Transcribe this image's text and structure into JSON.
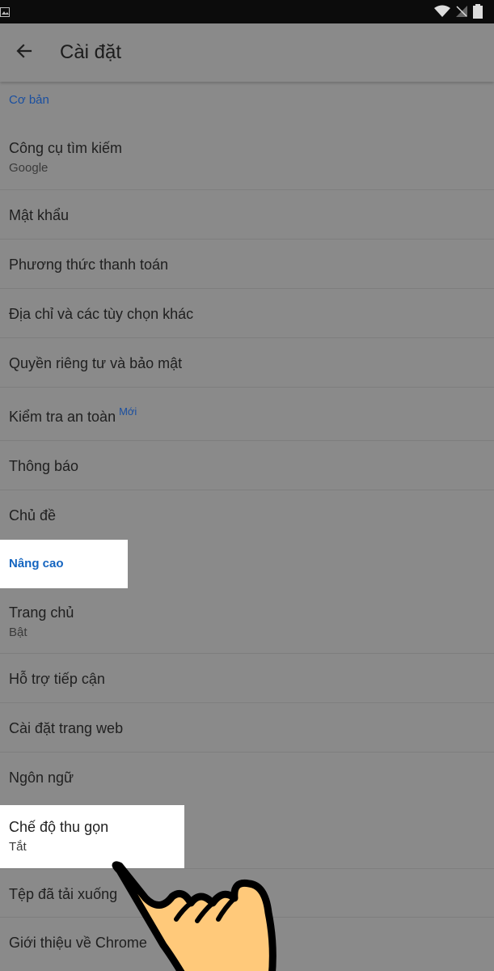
{
  "title": "Cài đặt",
  "sections": [
    {
      "header": "Cơ bản",
      "items": [
        {
          "label": "Công cụ tìm kiếm",
          "sub": "Google"
        },
        {
          "label": "Mật khẩu"
        },
        {
          "label": "Phương thức thanh toán"
        },
        {
          "label": "Địa chỉ và các tùy chọn khác"
        },
        {
          "label": "Quyền riêng tư và bảo mật"
        },
        {
          "label": "Kiểm tra an toàn",
          "badge": "Mới"
        },
        {
          "label": "Thông báo"
        },
        {
          "label": "Chủ đề"
        }
      ]
    },
    {
      "header": "Nâng cao",
      "items": [
        {
          "label": "Trang chủ",
          "sub": "Bật"
        },
        {
          "label": "Hỗ trợ tiếp cận"
        },
        {
          "label": "Cài đặt trang web"
        },
        {
          "label": "Ngôn ngữ"
        },
        {
          "label": "Chế độ thu gọn",
          "sub": "Tắt"
        },
        {
          "label": "Tệp đã tải xuống"
        },
        {
          "label": "Giới thiệu về Chrome"
        }
      ]
    }
  ],
  "colors": {
    "accent": "#1a4fa0",
    "highlight": "#ffffff",
    "dim_background": "#8a8a8a",
    "hand_fill": "#ffc97a"
  },
  "icons": {
    "back": "arrow-left-icon",
    "wifi": "wifi-icon",
    "signal": "no-signal-icon",
    "battery": "battery-icon",
    "pointer": "pointing-hand-icon"
  }
}
